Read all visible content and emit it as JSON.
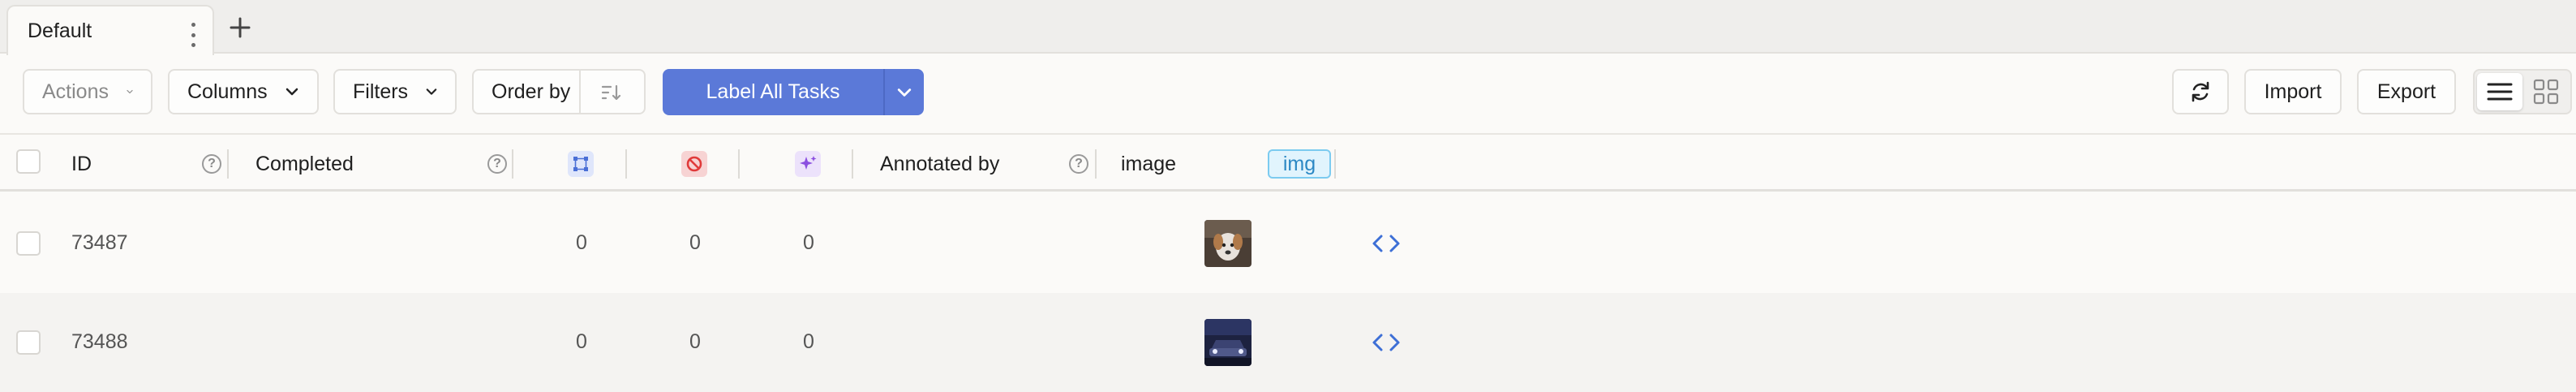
{
  "tabs": [
    {
      "label": "Default"
    }
  ],
  "toolbar": {
    "actions": "Actions",
    "columns": "Columns",
    "filters": "Filters",
    "order_by": "Order by",
    "label_all": "Label All Tasks",
    "import": "Import",
    "export": "Export"
  },
  "table": {
    "headers": {
      "id": "ID",
      "completed": "Completed",
      "annotated_by": "Annotated by",
      "image": "image",
      "image_tag": "img"
    },
    "rows": [
      {
        "id": "73487",
        "annotations": "0",
        "cancelled": "0",
        "predictions": "0",
        "thumbnail": "dog-photo"
      },
      {
        "id": "73488",
        "annotations": "0",
        "cancelled": "0",
        "predictions": "0",
        "thumbnail": "car-photo"
      }
    ]
  },
  "colors": {
    "primary": "#5b79d8",
    "annotations_icon_bg": "#dfe6fb",
    "cancelled_icon_bg": "#f7d3d3",
    "predictions_icon_bg": "#ece2fb",
    "tag_bg": "#e1f4fd"
  }
}
